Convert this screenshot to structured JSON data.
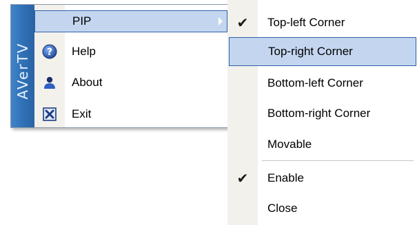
{
  "main_menu": {
    "side_label": "AVerTV",
    "items": [
      {
        "label": "PIP",
        "icon": "none",
        "has_submenu": true,
        "highlighted": true
      },
      {
        "label": "Help",
        "icon": "help-icon"
      },
      {
        "label": "About",
        "icon": "person-icon"
      },
      {
        "label": "Exit",
        "icon": "close-box-icon"
      }
    ]
  },
  "pip_submenu": {
    "items": [
      {
        "label": "Top-left Corner",
        "checked": true
      },
      {
        "label": "Top-right Corner",
        "checked": false,
        "highlighted": true
      },
      {
        "label": "Bottom-left Corner",
        "checked": false
      },
      {
        "label": "Bottom-right Corner",
        "checked": false
      },
      {
        "label": "Movable",
        "checked": false
      },
      {
        "label": "Enable",
        "checked": true
      },
      {
        "label": "Close",
        "checked": false
      }
    ],
    "check_glyph": "✔"
  },
  "colors": {
    "highlight_fill": "#c4d6ef",
    "highlight_border": "#2c5ea8",
    "side_bar": "#2f6fb4",
    "gutter": "#f2f1ec"
  }
}
